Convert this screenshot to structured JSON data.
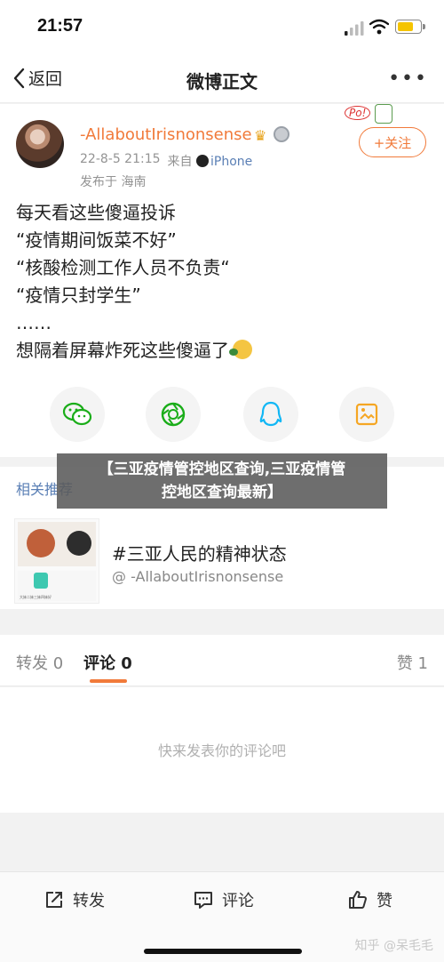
{
  "status": {
    "time": "21:57"
  },
  "nav": {
    "back_label": "返回",
    "title": "微博正文",
    "more_label": "•••"
  },
  "post": {
    "username": "-AllaboutIrisnonsense",
    "timestamp": "22-8-5 21:15",
    "source_prefix": "来自",
    "source": "iPhone",
    "location": "发布于 海南",
    "follow_label": "+关注",
    "sticker_text": "Po!",
    "lines": [
      "每天看这些傻逼投诉",
      "“疫情期间饭菜不好”",
      "“核酸检测工作人员不负责“",
      "“疫情只封学生”",
      "……",
      "想隔着屏幕炸死这些傻逼了"
    ]
  },
  "banner": {
    "line1": "【三亚疫情管控地区查询,三亚疫情管",
    "line2": "控地区查询最新】"
  },
  "related": {
    "header": "相关推荐",
    "title": "#三亚人民的精神状态",
    "author": "@ -AllaboutIrisnonsense",
    "thumb_caption": "大妹二妹三妹四妹好"
  },
  "tabs": {
    "repost": "转发 0",
    "comment": "评论 0",
    "like": "赞 1"
  },
  "comments": {
    "empty_text": "快来发表你的评论吧"
  },
  "bottom": {
    "repost": "转发",
    "comment": "评论",
    "like": "赞",
    "watermark": "知乎 @呆毛毛"
  },
  "colors": {
    "accent": "#f17a3a",
    "link": "#5a7fb5",
    "wechat": "#1aad19",
    "qq": "#12b7f5"
  }
}
